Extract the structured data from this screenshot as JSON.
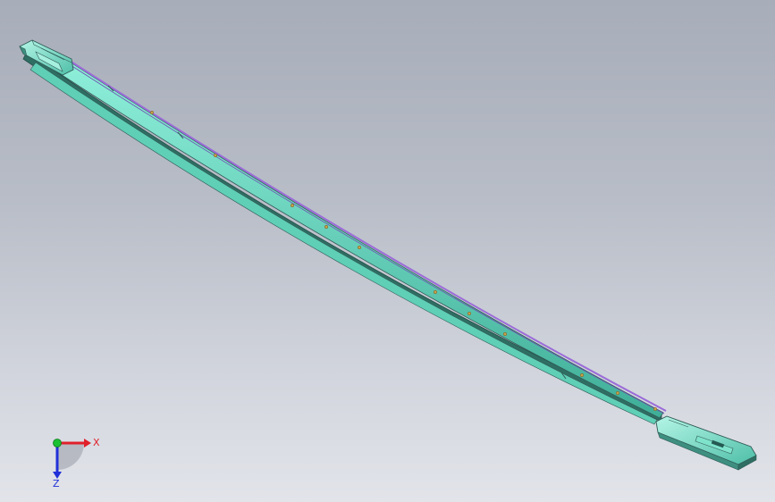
{
  "viewport": {
    "background_top": "#a7adb9",
    "background_bottom": "#e2e4ea"
  },
  "model": {
    "body_color": "#6fe0c8",
    "body_shadow_color": "#3e8f80",
    "edge_color": "#2f5a55",
    "stripe_color": "#9b6cd8",
    "fastener_color": "#c8a24a"
  },
  "triad": {
    "x_label": "X",
    "z_label": "Z",
    "x_color": "#e0202a",
    "y_color": "#19c030",
    "z_color": "#2030d8"
  }
}
